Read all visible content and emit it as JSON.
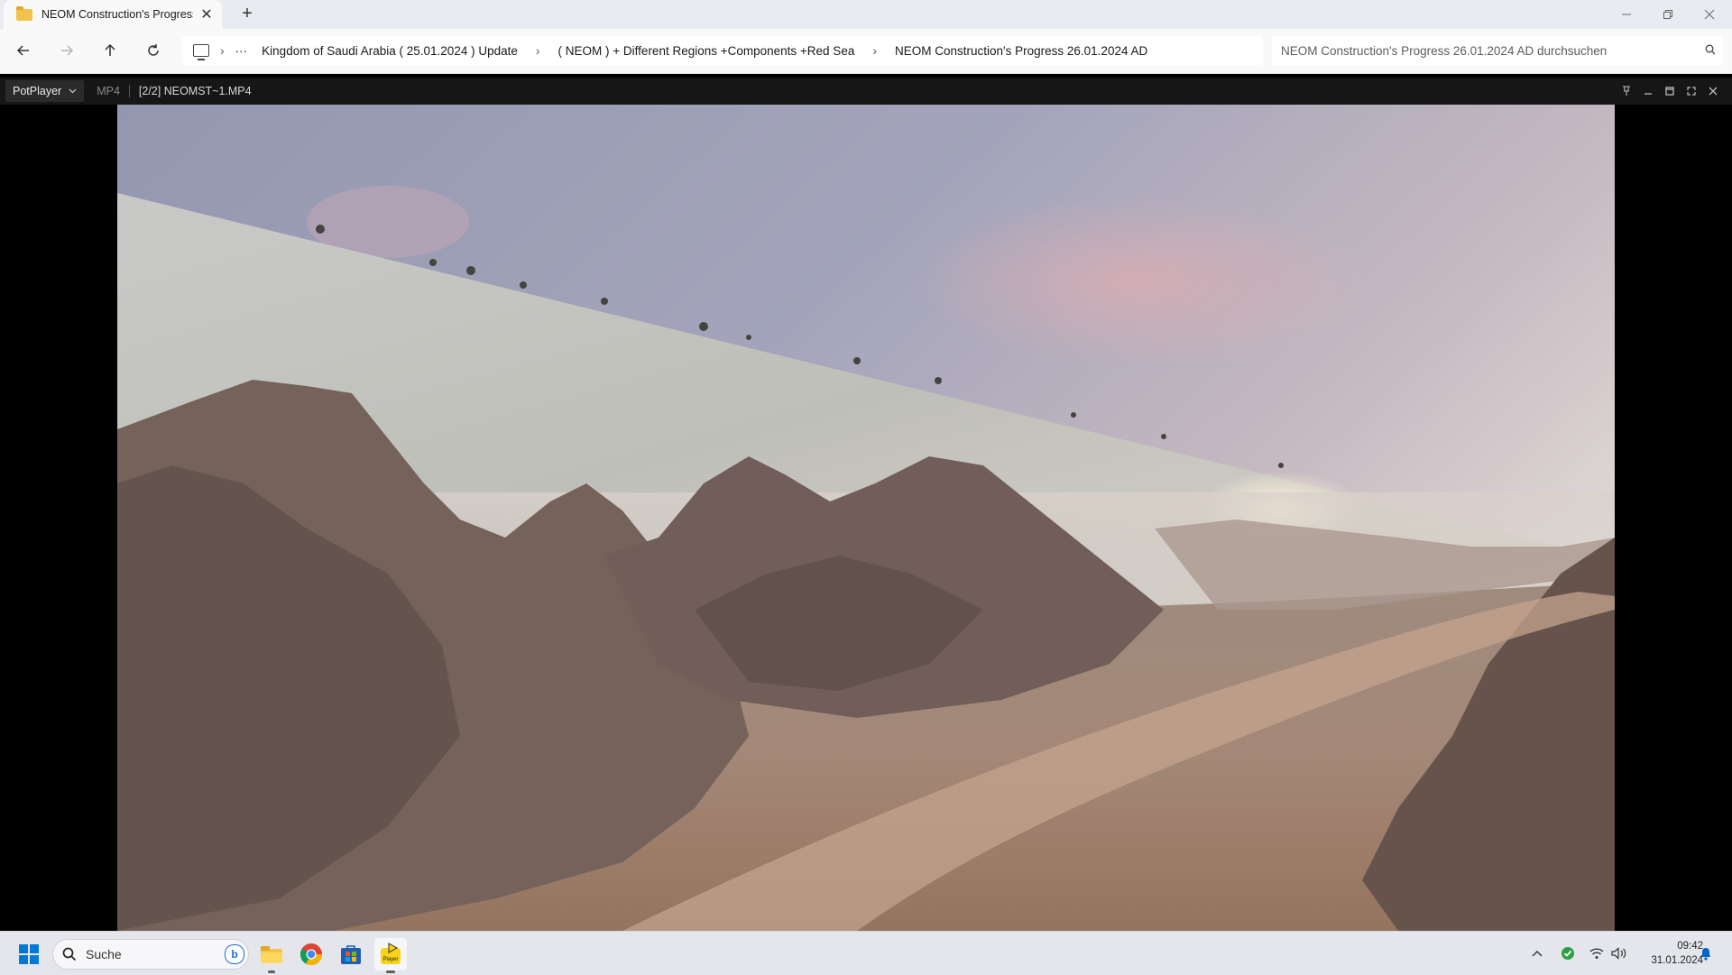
{
  "explorer": {
    "tab_title": "NEOM Construction's Progress",
    "tab_close": "✕",
    "new_tab": "+",
    "breadcrumb": [
      "Kingdom of Saudi Arabia ( 25.01.2024 ) Update",
      "( NEOM ) + Different Regions +Components +Red Sea",
      "NEOM Construction's Progress 26.01.2024 AD"
    ],
    "breadcrumb_more": "···",
    "search_placeholder": "NEOM Construction's Progress 26.01.2024 AD durchsuchen"
  },
  "player": {
    "name": "PotPlayer",
    "format": "MP4",
    "file": "[2/2] NEOMST~1.MP4"
  },
  "taskbar": {
    "search_label": "Suche",
    "pinned_apps": [
      "windows-start",
      "file-explorer",
      "chrome",
      "microsoft-store",
      "potplayer"
    ],
    "time": "09:42",
    "date": "31.01.2024"
  },
  "colors": {
    "accent": "#0067c0",
    "player_bg": "#161616",
    "taskbar_bg": "#e4e6ec"
  }
}
